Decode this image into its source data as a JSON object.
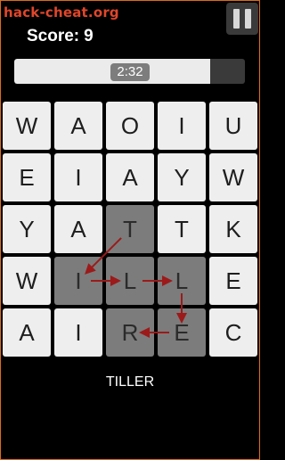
{
  "watermark": "hack-cheat.org",
  "score": {
    "label": "Score:",
    "value": "9"
  },
  "timer": {
    "text": "2:32",
    "progress": 0.85
  },
  "board": {
    "rows": [
      [
        "W",
        "A",
        "O",
        "I",
        "U"
      ],
      [
        "E",
        "I",
        "A",
        "Y",
        "W"
      ],
      [
        "Y",
        "A",
        "T",
        "T",
        "K"
      ],
      [
        "W",
        "I",
        "L",
        "L",
        "E"
      ],
      [
        "A",
        "I",
        "R",
        "E",
        "C"
      ]
    ],
    "path": [
      [
        2,
        2
      ],
      [
        3,
        1
      ],
      [
        3,
        2
      ],
      [
        3,
        3
      ],
      [
        4,
        3
      ],
      [
        4,
        2
      ]
    ],
    "path_color": "#9c1a1a",
    "selected_color": "#7c7c7c"
  },
  "current_word": "TILLER"
}
